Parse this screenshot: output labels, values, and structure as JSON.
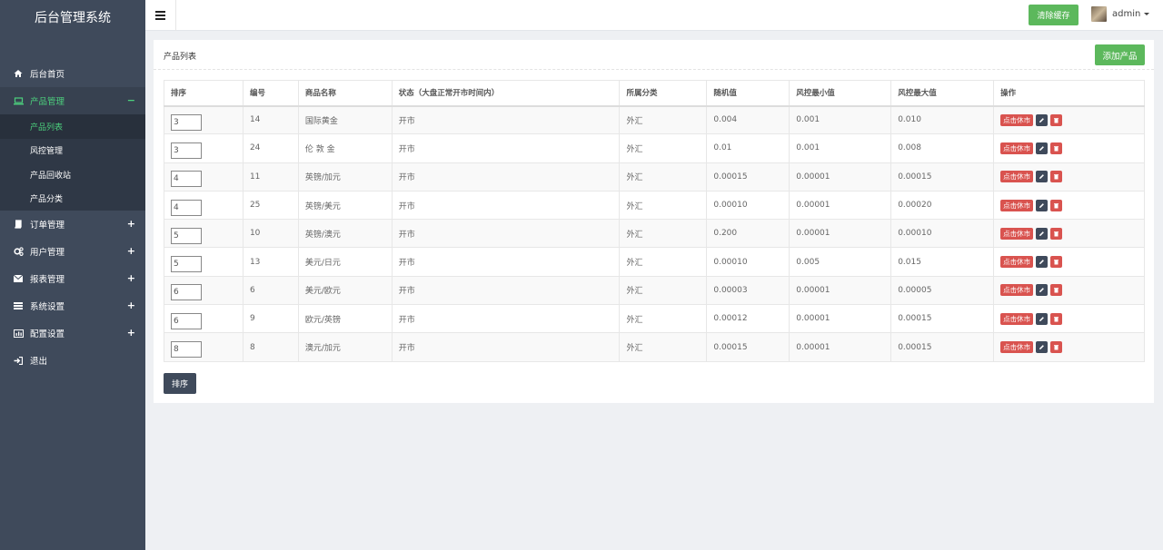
{
  "brand": "后台管理系统",
  "menu": [
    {
      "label": "后台首页",
      "icon": "home-icon",
      "sign": ""
    },
    {
      "label": "产品管理",
      "icon": "laptop-icon",
      "sign": "−"
    },
    {
      "label": "订单管理",
      "icon": "book-icon",
      "sign": "+"
    },
    {
      "label": "用户管理",
      "icon": "gears-icon",
      "sign": "+"
    },
    {
      "label": "报表管理",
      "icon": "envelope-icon",
      "sign": "+"
    },
    {
      "label": "系统设置",
      "icon": "list-icon",
      "sign": "+"
    },
    {
      "label": "配置设置",
      "icon": "chart-icon",
      "sign": "+"
    },
    {
      "label": "退出",
      "icon": "logout-icon",
      "sign": ""
    }
  ],
  "submenu": [
    "产品列表",
    "风控管理",
    "产品回收站",
    "产品分类"
  ],
  "topbar": {
    "clear_cache": "清除缓存",
    "user": "admin"
  },
  "panel": {
    "title": "产品列表",
    "add_label": "添加产品",
    "sort_label": "排序"
  },
  "table": {
    "headers": [
      "排序",
      "编号",
      "商品名称",
      "状态（大盘正常开市时间内）",
      "所属分类",
      "随机值",
      "风控最小值",
      "风控最大值",
      "操作"
    ],
    "rows": [
      [
        "3",
        "14",
        "国际黄金",
        "开市",
        "外汇",
        "0.004",
        "0.001",
        "0.010"
      ],
      [
        "3",
        "24",
        "伦 敦 金",
        "开市",
        "外汇",
        "0.01",
        "0.001",
        "0.008"
      ],
      [
        "4",
        "11",
        "英镑/加元",
        "开市",
        "外汇",
        "0.00015",
        "0.00001",
        "0.00015"
      ],
      [
        "4",
        "25",
        "英镑/美元",
        "开市",
        "外汇",
        "0.00010",
        "0.00001",
        "0.00020"
      ],
      [
        "5",
        "10",
        "英镑/澳元",
        "开市",
        "外汇",
        "0.200",
        "0.00001",
        "0.00010"
      ],
      [
        "5",
        "13",
        "美元/日元",
        "开市",
        "外汇",
        "0.00010",
        "0.005",
        "0.015"
      ],
      [
        "6",
        "6",
        "美元/欧元",
        "开市",
        "外汇",
        "0.00003",
        "0.00001",
        "0.00005"
      ],
      [
        "6",
        "9",
        "欧元/英镑",
        "开市",
        "外汇",
        "0.00012",
        "0.00001",
        "0.00015"
      ],
      [
        "8",
        "8",
        "澳元/加元",
        "开市",
        "外汇",
        "0.00015",
        "0.00001",
        "0.00015"
      ]
    ],
    "op_label": "点击休市"
  },
  "colors": {
    "sidebar": "#3f4a5b",
    "accent_green": "#5cb85c",
    "danger": "#d9534f"
  }
}
